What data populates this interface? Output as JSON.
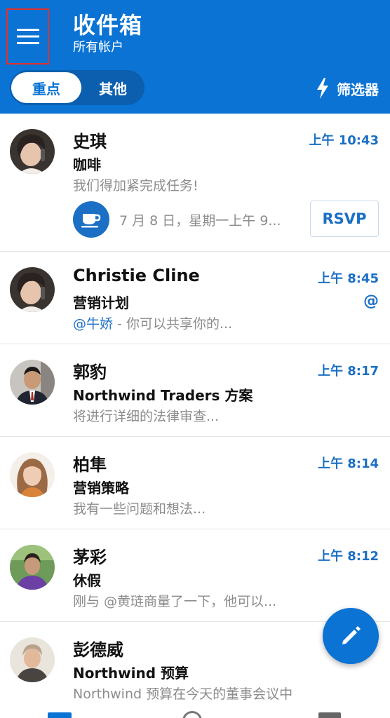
{
  "header": {
    "title": "收件箱",
    "subtitle": "所有帐户",
    "tabs": {
      "focused": "重点",
      "other": "其他"
    },
    "filter_label": "筛选器"
  },
  "messages": [
    {
      "sender": "史琪",
      "time": "上午 10:43",
      "subject": "咖啡",
      "preview": "我们得加紧完成任务!",
      "event_text": "7 月 8 日，星期一上午 9...",
      "rsvp_label": "RSVP"
    },
    {
      "sender": "Christie Cline",
      "time": "上午 8:45",
      "subject": "营销计划",
      "preview_mention": "@牛娇",
      "preview": " - 你可以共享你的...",
      "mention_badge": "@"
    },
    {
      "sender": "郭豹",
      "time": "上午 8:17",
      "subject": "Northwind Traders 方案",
      "preview": "将进行详细的法律审查..."
    },
    {
      "sender": "柏隼",
      "time": "上午 8:14",
      "subject": "营销策略",
      "preview": "我有一些问题和想法..."
    },
    {
      "sender": "茅彩",
      "time": "上午 8:12",
      "subject": "休假",
      "preview": "刚与 @黄琏商量了一下，他可以..."
    },
    {
      "sender": "彭德威",
      "time": "",
      "subject": "Northwind 预算",
      "preview": "Northwind 预算在今天的董事会议中"
    }
  ],
  "icons": {
    "menu": "hamburger-menu-icon",
    "filter": "lightning-icon",
    "event": "coffee-cup-icon",
    "compose": "pencil-icon",
    "nav": [
      "mail-icon",
      "search-icon",
      "calendar-icon"
    ]
  },
  "colors": {
    "header_bg": "#0a73d4",
    "accent": "#1b6fc4",
    "preview_text": "#8c8c8c",
    "highlight_box": "#e3312d"
  }
}
